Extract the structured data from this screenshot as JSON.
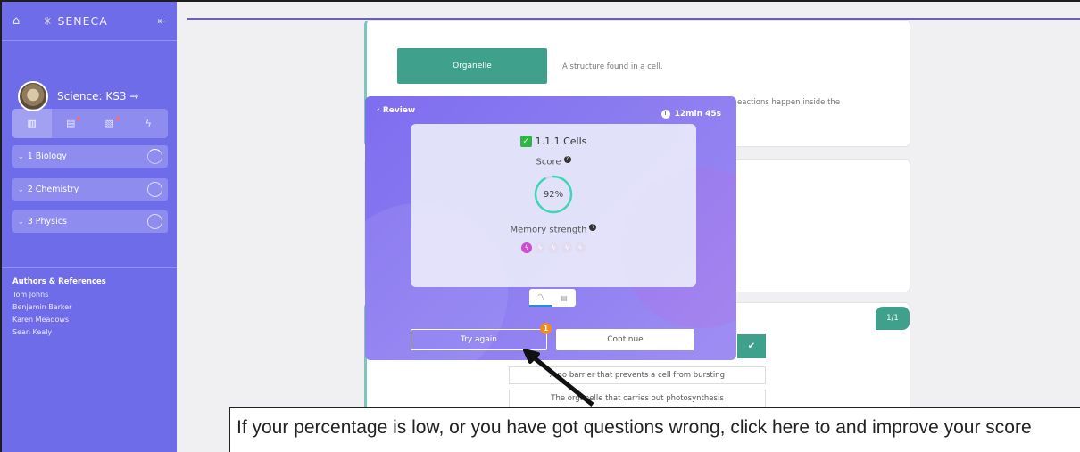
{
  "sidebar": {
    "logo": "SENECA",
    "course_title": "Science: KS3 →",
    "sections": [
      {
        "label": "1 Biology"
      },
      {
        "label": "2 Chemistry"
      },
      {
        "label": "3 Physics"
      }
    ],
    "authors_heading": "Authors & References",
    "authors": [
      "Tom Johns",
      "Benjamin Barker",
      "Karen Meadows",
      "Sean Kealy"
    ]
  },
  "background": {
    "term": "Organelle",
    "definition1": "A structure found in a cell.",
    "definition2_fragment": "eactions happen inside the",
    "pager": "1/1",
    "option1": "A no   barrier that prevents a cell from bursting",
    "option2": "The organelle that carries out photosynthesis"
  },
  "modal": {
    "review_label": "Review",
    "timer": "12min 45s",
    "topic": "1.1.1 Cells",
    "score_label": "Score",
    "score_value": "92%",
    "score_fraction": 0.92,
    "memory_label": "Memory strength",
    "memory_level": 1,
    "memory_max": 5,
    "try_again": "Try again",
    "continue": "Continue",
    "badge": "1"
  },
  "annotation": {
    "text": "If your percentage is low, or you have got questions wrong, click here to and improve your score"
  },
  "colors": {
    "sidebar": "#6f6ce9",
    "modal": "#8a7af0",
    "teal": "#3fa08c",
    "badge": "#f08a1e",
    "memory_on": "#c94fd0"
  }
}
